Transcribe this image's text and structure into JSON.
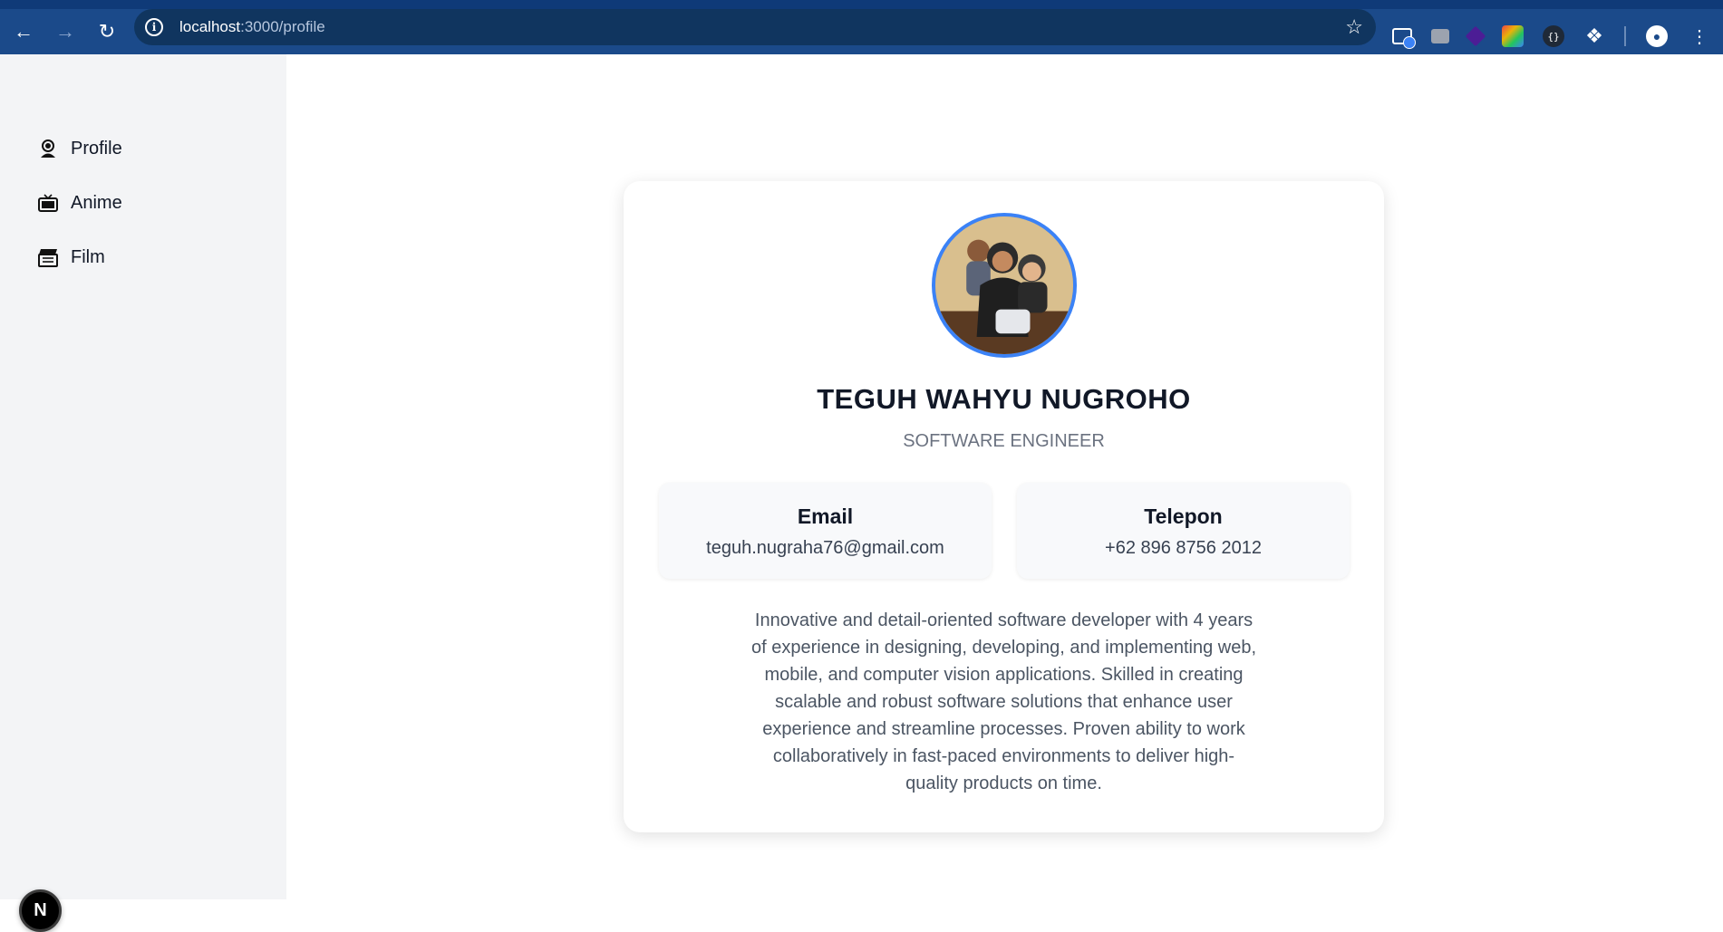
{
  "browser": {
    "url_host": "localhost",
    "url_path": ":3000/profile"
  },
  "sidebar": {
    "items": [
      {
        "label": "Profile",
        "icon": "user-icon"
      },
      {
        "label": "Anime",
        "icon": "tv-icon"
      },
      {
        "label": "Film",
        "icon": "clapperboard-icon"
      }
    ],
    "badge": "N"
  },
  "profile": {
    "name": "TEGUH WAHYU NUGROHO",
    "title": "SOFTWARE ENGINEER",
    "email_label": "Email",
    "email": "teguh.nugraha76@gmail.com",
    "phone_label": "Telepon",
    "phone": "+62 896 8756 2012",
    "bio": "Innovative and detail-oriented software developer with 4 years of experience in designing, developing, and implementing web, mobile, and computer vision applications. Skilled in creating scalable and robust software solutions that enhance user experience and streamline processes. Proven ability to work collaboratively in fast-paced environments to deliver high-quality products on time."
  },
  "colors": {
    "accent": "#3b82f6",
    "browser_bar": "#1b4a8a",
    "sidebar_bg": "#f3f4f6"
  }
}
